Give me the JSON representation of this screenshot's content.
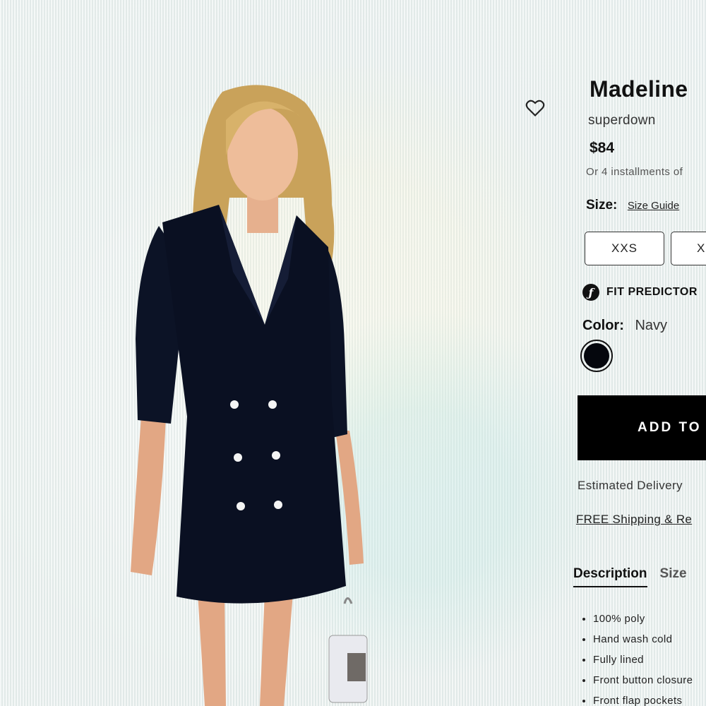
{
  "product": {
    "title": "Madeline",
    "brand": "superdown",
    "price": "$84",
    "installments": "Or 4 installments of"
  },
  "size": {
    "label": "Size:",
    "guide_label": "Size Guide",
    "options": [
      "XXS",
      "X"
    ]
  },
  "fit_predictor": {
    "label": "FIT PREDICTOR",
    "icon": "fit-predictor-icon"
  },
  "color": {
    "label": "Color:",
    "value": "Navy",
    "swatch_hex": "#05070d"
  },
  "cart": {
    "add_label": "ADD TO"
  },
  "delivery_text": "Estimated Delivery",
  "shipping_link": "FREE Shipping & Re",
  "tabs": [
    {
      "label": "Description"
    },
    {
      "label": "Size"
    }
  ],
  "description": {
    "bullets": [
      "100% poly",
      "Hand wash cold",
      "Fully lined",
      "Front button closure",
      "Front flap pockets"
    ]
  },
  "icons": {
    "wishlist": "heart-icon"
  }
}
